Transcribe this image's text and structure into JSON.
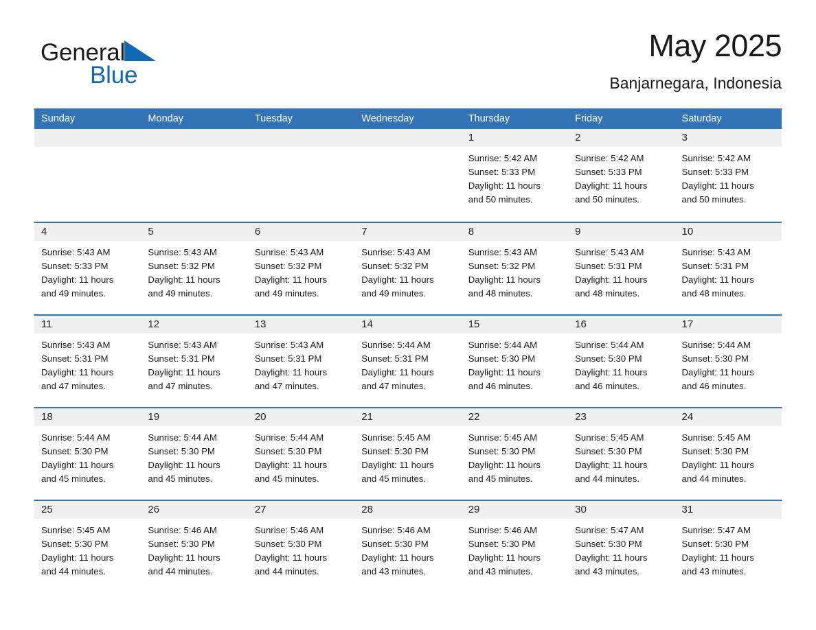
{
  "brand": {
    "name_part1": "General",
    "name_part2": "Blue",
    "logo_icon": "triangle-flag-icon",
    "accent_color": "#1168b3"
  },
  "header": {
    "title": "May 2025",
    "subtitle": "Banjarnegara, Indonesia"
  },
  "theme": {
    "header_blue": "#3173b5",
    "daynum_gray": "#f0f0f0",
    "text": "#1a1a1a"
  },
  "calendar": {
    "weekday_headers": [
      "Sunday",
      "Monday",
      "Tuesday",
      "Wednesday",
      "Thursday",
      "Friday",
      "Saturday"
    ],
    "labels": {
      "sunrise": "Sunrise:",
      "sunset": "Sunset:",
      "daylight": "Daylight:"
    },
    "weeks": [
      [
        {
          "day": "",
          "sunrise": "",
          "sunset": "",
          "daylight_line1": "",
          "daylight_line2": "",
          "empty": true
        },
        {
          "day": "",
          "sunrise": "",
          "sunset": "",
          "daylight_line1": "",
          "daylight_line2": "",
          "empty": true
        },
        {
          "day": "",
          "sunrise": "",
          "sunset": "",
          "daylight_line1": "",
          "daylight_line2": "",
          "empty": true
        },
        {
          "day": "",
          "sunrise": "",
          "sunset": "",
          "daylight_line1": "",
          "daylight_line2": "",
          "empty": true
        },
        {
          "day": "1",
          "sunrise": "Sunrise: 5:42 AM",
          "sunset": "Sunset: 5:33 PM",
          "daylight_line1": "Daylight: 11 hours",
          "daylight_line2": "and 50 minutes.",
          "empty": false
        },
        {
          "day": "2",
          "sunrise": "Sunrise: 5:42 AM",
          "sunset": "Sunset: 5:33 PM",
          "daylight_line1": "Daylight: 11 hours",
          "daylight_line2": "and 50 minutes.",
          "empty": false
        },
        {
          "day": "3",
          "sunrise": "Sunrise: 5:42 AM",
          "sunset": "Sunset: 5:33 PM",
          "daylight_line1": "Daylight: 11 hours",
          "daylight_line2": "and 50 minutes.",
          "empty": false
        }
      ],
      [
        {
          "day": "4",
          "sunrise": "Sunrise: 5:43 AM",
          "sunset": "Sunset: 5:33 PM",
          "daylight_line1": "Daylight: 11 hours",
          "daylight_line2": "and 49 minutes.",
          "empty": false
        },
        {
          "day": "5",
          "sunrise": "Sunrise: 5:43 AM",
          "sunset": "Sunset: 5:32 PM",
          "daylight_line1": "Daylight: 11 hours",
          "daylight_line2": "and 49 minutes.",
          "empty": false
        },
        {
          "day": "6",
          "sunrise": "Sunrise: 5:43 AM",
          "sunset": "Sunset: 5:32 PM",
          "daylight_line1": "Daylight: 11 hours",
          "daylight_line2": "and 49 minutes.",
          "empty": false
        },
        {
          "day": "7",
          "sunrise": "Sunrise: 5:43 AM",
          "sunset": "Sunset: 5:32 PM",
          "daylight_line1": "Daylight: 11 hours",
          "daylight_line2": "and 49 minutes.",
          "empty": false
        },
        {
          "day": "8",
          "sunrise": "Sunrise: 5:43 AM",
          "sunset": "Sunset: 5:32 PM",
          "daylight_line1": "Daylight: 11 hours",
          "daylight_line2": "and 48 minutes.",
          "empty": false
        },
        {
          "day": "9",
          "sunrise": "Sunrise: 5:43 AM",
          "sunset": "Sunset: 5:31 PM",
          "daylight_line1": "Daylight: 11 hours",
          "daylight_line2": "and 48 minutes.",
          "empty": false
        },
        {
          "day": "10",
          "sunrise": "Sunrise: 5:43 AM",
          "sunset": "Sunset: 5:31 PM",
          "daylight_line1": "Daylight: 11 hours",
          "daylight_line2": "and 48 minutes.",
          "empty": false
        }
      ],
      [
        {
          "day": "11",
          "sunrise": "Sunrise: 5:43 AM",
          "sunset": "Sunset: 5:31 PM",
          "daylight_line1": "Daylight: 11 hours",
          "daylight_line2": "and 47 minutes.",
          "empty": false
        },
        {
          "day": "12",
          "sunrise": "Sunrise: 5:43 AM",
          "sunset": "Sunset: 5:31 PM",
          "daylight_line1": "Daylight: 11 hours",
          "daylight_line2": "and 47 minutes.",
          "empty": false
        },
        {
          "day": "13",
          "sunrise": "Sunrise: 5:43 AM",
          "sunset": "Sunset: 5:31 PM",
          "daylight_line1": "Daylight: 11 hours",
          "daylight_line2": "and 47 minutes.",
          "empty": false
        },
        {
          "day": "14",
          "sunrise": "Sunrise: 5:44 AM",
          "sunset": "Sunset: 5:31 PM",
          "daylight_line1": "Daylight: 11 hours",
          "daylight_line2": "and 47 minutes.",
          "empty": false
        },
        {
          "day": "15",
          "sunrise": "Sunrise: 5:44 AM",
          "sunset": "Sunset: 5:30 PM",
          "daylight_line1": "Daylight: 11 hours",
          "daylight_line2": "and 46 minutes.",
          "empty": false
        },
        {
          "day": "16",
          "sunrise": "Sunrise: 5:44 AM",
          "sunset": "Sunset: 5:30 PM",
          "daylight_line1": "Daylight: 11 hours",
          "daylight_line2": "and 46 minutes.",
          "empty": false
        },
        {
          "day": "17",
          "sunrise": "Sunrise: 5:44 AM",
          "sunset": "Sunset: 5:30 PM",
          "daylight_line1": "Daylight: 11 hours",
          "daylight_line2": "and 46 minutes.",
          "empty": false
        }
      ],
      [
        {
          "day": "18",
          "sunrise": "Sunrise: 5:44 AM",
          "sunset": "Sunset: 5:30 PM",
          "daylight_line1": "Daylight: 11 hours",
          "daylight_line2": "and 45 minutes.",
          "empty": false
        },
        {
          "day": "19",
          "sunrise": "Sunrise: 5:44 AM",
          "sunset": "Sunset: 5:30 PM",
          "daylight_line1": "Daylight: 11 hours",
          "daylight_line2": "and 45 minutes.",
          "empty": false
        },
        {
          "day": "20",
          "sunrise": "Sunrise: 5:44 AM",
          "sunset": "Sunset: 5:30 PM",
          "daylight_line1": "Daylight: 11 hours",
          "daylight_line2": "and 45 minutes.",
          "empty": false
        },
        {
          "day": "21",
          "sunrise": "Sunrise: 5:45 AM",
          "sunset": "Sunset: 5:30 PM",
          "daylight_line1": "Daylight: 11 hours",
          "daylight_line2": "and 45 minutes.",
          "empty": false
        },
        {
          "day": "22",
          "sunrise": "Sunrise: 5:45 AM",
          "sunset": "Sunset: 5:30 PM",
          "daylight_line1": "Daylight: 11 hours",
          "daylight_line2": "and 45 minutes.",
          "empty": false
        },
        {
          "day": "23",
          "sunrise": "Sunrise: 5:45 AM",
          "sunset": "Sunset: 5:30 PM",
          "daylight_line1": "Daylight: 11 hours",
          "daylight_line2": "and 44 minutes.",
          "empty": false
        },
        {
          "day": "24",
          "sunrise": "Sunrise: 5:45 AM",
          "sunset": "Sunset: 5:30 PM",
          "daylight_line1": "Daylight: 11 hours",
          "daylight_line2": "and 44 minutes.",
          "empty": false
        }
      ],
      [
        {
          "day": "25",
          "sunrise": "Sunrise: 5:45 AM",
          "sunset": "Sunset: 5:30 PM",
          "daylight_line1": "Daylight: 11 hours",
          "daylight_line2": "and 44 minutes.",
          "empty": false
        },
        {
          "day": "26",
          "sunrise": "Sunrise: 5:46 AM",
          "sunset": "Sunset: 5:30 PM",
          "daylight_line1": "Daylight: 11 hours",
          "daylight_line2": "and 44 minutes.",
          "empty": false
        },
        {
          "day": "27",
          "sunrise": "Sunrise: 5:46 AM",
          "sunset": "Sunset: 5:30 PM",
          "daylight_line1": "Daylight: 11 hours",
          "daylight_line2": "and 44 minutes.",
          "empty": false
        },
        {
          "day": "28",
          "sunrise": "Sunrise: 5:46 AM",
          "sunset": "Sunset: 5:30 PM",
          "daylight_line1": "Daylight: 11 hours",
          "daylight_line2": "and 43 minutes.",
          "empty": false
        },
        {
          "day": "29",
          "sunrise": "Sunrise: 5:46 AM",
          "sunset": "Sunset: 5:30 PM",
          "daylight_line1": "Daylight: 11 hours",
          "daylight_line2": "and 43 minutes.",
          "empty": false
        },
        {
          "day": "30",
          "sunrise": "Sunrise: 5:47 AM",
          "sunset": "Sunset: 5:30 PM",
          "daylight_line1": "Daylight: 11 hours",
          "daylight_line2": "and 43 minutes.",
          "empty": false
        },
        {
          "day": "31",
          "sunrise": "Sunrise: 5:47 AM",
          "sunset": "Sunset: 5:30 PM",
          "daylight_line1": "Daylight: 11 hours",
          "daylight_line2": "and 43 minutes.",
          "empty": false
        }
      ]
    ]
  }
}
